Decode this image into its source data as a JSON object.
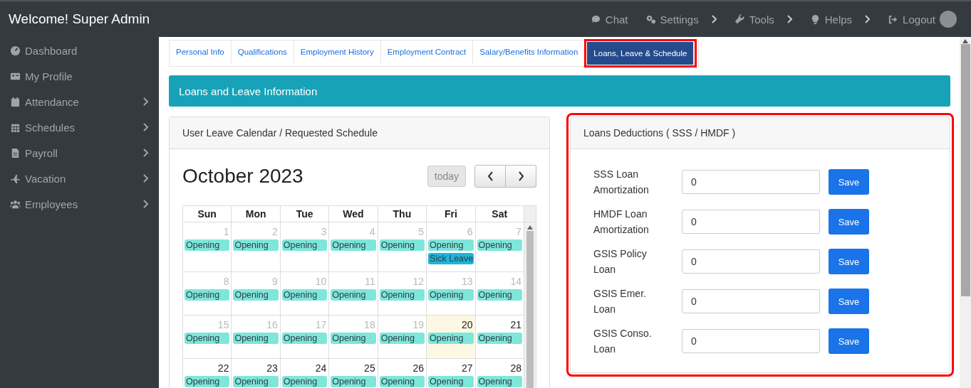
{
  "header": {
    "title": "Welcome! Super Admin",
    "nav": [
      {
        "label": "Chat",
        "submenu": false
      },
      {
        "label": "Settings",
        "submenu": true
      },
      {
        "label": "Tools",
        "submenu": true
      },
      {
        "label": "Helps",
        "submenu": true
      },
      {
        "label": "Logout",
        "submenu": false
      }
    ]
  },
  "sidebar": {
    "items": [
      {
        "label": "Dashboard",
        "submenu": false
      },
      {
        "label": "My Profile",
        "submenu": false
      },
      {
        "label": "Attendance",
        "submenu": true
      },
      {
        "label": "Schedules",
        "submenu": true
      },
      {
        "label": "Payroll",
        "submenu": true
      },
      {
        "label": "Vacation",
        "submenu": true
      },
      {
        "label": "Employees",
        "submenu": true
      }
    ]
  },
  "tabs": [
    {
      "label": "Personal Info",
      "selected": false,
      "highlighted": false
    },
    {
      "label": "Qualifications",
      "selected": false,
      "highlighted": false
    },
    {
      "label": "Employment History",
      "selected": false,
      "highlighted": false
    },
    {
      "label": "Employment Contract",
      "selected": false,
      "highlighted": false
    },
    {
      "label": "Salary/Benefits Information",
      "selected": false,
      "highlighted": false
    },
    {
      "label": "Loans, Leave & Schedule",
      "selected": true,
      "highlighted": true
    }
  ],
  "banner": {
    "title": "Loans and Leave Information"
  },
  "calendar": {
    "panel_title": "User Leave Calendar / Requested Schedule",
    "month": "October 2023",
    "today_button": {
      "label": "today",
      "disabled": true
    },
    "weekdays": [
      "Sun",
      "Mon",
      "Tue",
      "Wed",
      "Thu",
      "Fri",
      "Sat"
    ],
    "weeks": [
      [
        {
          "day": "1",
          "past": true,
          "today": false,
          "events": [
            {
              "label": "Opening",
              "color": "#7fe6da"
            }
          ]
        },
        {
          "day": "2",
          "past": true,
          "today": false,
          "events": [
            {
              "label": "Opening",
              "color": "#7fe6da"
            }
          ]
        },
        {
          "day": "3",
          "past": true,
          "today": false,
          "events": [
            {
              "label": "Opening",
              "color": "#7fe6da"
            }
          ]
        },
        {
          "day": "4",
          "past": true,
          "today": false,
          "events": [
            {
              "label": "Opening",
              "color": "#7fe6da"
            }
          ]
        },
        {
          "day": "5",
          "past": true,
          "today": false,
          "events": [
            {
              "label": "Opening",
              "color": "#7fe6da"
            }
          ]
        },
        {
          "day": "6",
          "past": true,
          "today": false,
          "events": [
            {
              "label": "Opening",
              "color": "#7fe6da"
            },
            {
              "label": "Sick Leave",
              "color": "#1eb4dc"
            }
          ]
        },
        {
          "day": "7",
          "past": true,
          "today": false,
          "events": [
            {
              "label": "Opening",
              "color": "#7fe6da"
            }
          ]
        }
      ],
      [
        {
          "day": "8",
          "past": true,
          "today": false,
          "events": [
            {
              "label": "Opening",
              "color": "#7fe6da"
            }
          ]
        },
        {
          "day": "9",
          "past": true,
          "today": false,
          "events": [
            {
              "label": "Opening",
              "color": "#7fe6da"
            }
          ]
        },
        {
          "day": "10",
          "past": true,
          "today": false,
          "events": [
            {
              "label": "Opening",
              "color": "#7fe6da"
            }
          ]
        },
        {
          "day": "11",
          "past": true,
          "today": false,
          "events": [
            {
              "label": "Opening",
              "color": "#7fe6da"
            }
          ]
        },
        {
          "day": "12",
          "past": true,
          "today": false,
          "events": [
            {
              "label": "Opening",
              "color": "#7fe6da"
            }
          ]
        },
        {
          "day": "13",
          "past": true,
          "today": false,
          "events": [
            {
              "label": "Opening",
              "color": "#7fe6da"
            }
          ]
        },
        {
          "day": "14",
          "past": true,
          "today": false,
          "events": [
            {
              "label": "Opening",
              "color": "#7fe6da"
            }
          ]
        }
      ],
      [
        {
          "day": "15",
          "past": true,
          "today": false,
          "events": [
            {
              "label": "Opening",
              "color": "#7fe6da"
            }
          ]
        },
        {
          "day": "16",
          "past": true,
          "today": false,
          "events": [
            {
              "label": "Opening",
              "color": "#7fe6da"
            }
          ]
        },
        {
          "day": "17",
          "past": true,
          "today": false,
          "events": [
            {
              "label": "Opening",
              "color": "#7fe6da"
            }
          ]
        },
        {
          "day": "18",
          "past": true,
          "today": false,
          "events": [
            {
              "label": "Opening",
              "color": "#7fe6da"
            }
          ]
        },
        {
          "day": "19",
          "past": true,
          "today": false,
          "events": [
            {
              "label": "Opening",
              "color": "#7fe6da"
            }
          ]
        },
        {
          "day": "20",
          "past": false,
          "today": true,
          "events": [
            {
              "label": "Opening",
              "color": "#7fe6da"
            }
          ]
        },
        {
          "day": "21",
          "past": false,
          "today": false,
          "events": [
            {
              "label": "Opening",
              "color": "#7fe6da"
            }
          ]
        }
      ],
      [
        {
          "day": "22",
          "past": false,
          "today": false,
          "events": [
            {
              "label": "Opening",
              "color": "#7fe6da"
            }
          ]
        },
        {
          "day": "23",
          "past": false,
          "today": false,
          "events": [
            {
              "label": "Opening",
              "color": "#7fe6da"
            }
          ]
        },
        {
          "day": "24",
          "past": false,
          "today": false,
          "events": [
            {
              "label": "Opening",
              "color": "#7fe6da"
            }
          ]
        },
        {
          "day": "25",
          "past": false,
          "today": false,
          "events": [
            {
              "label": "Opening",
              "color": "#7fe6da"
            }
          ]
        },
        {
          "day": "26",
          "past": false,
          "today": false,
          "events": [
            {
              "label": "Opening",
              "color": "#7fe6da"
            }
          ]
        },
        {
          "day": "27",
          "past": false,
          "today": false,
          "events": [
            {
              "label": "Opening",
              "color": "#7fe6da"
            }
          ]
        },
        {
          "day": "28",
          "past": false,
          "today": false,
          "events": [
            {
              "label": "Opening",
              "color": "#7fe6da"
            }
          ]
        }
      ]
    ]
  },
  "loans": {
    "panel_title": "Loans Deductions ( SSS / HMDF )",
    "highlighted": true,
    "rows": [
      {
        "label": "SSS Loan Amortization",
        "value": "0",
        "button": "Save"
      },
      {
        "label": "HMDF Loan Amortization",
        "value": "0",
        "button": "Save"
      },
      {
        "label": "GSIS Policy Loan",
        "value": "0",
        "button": "Save"
      },
      {
        "label": "GSIS Emer. Loan",
        "value": "0",
        "button": "Save"
      },
      {
        "label": "GSIS Conso. Loan",
        "value": "0",
        "button": "Save"
      }
    ]
  }
}
